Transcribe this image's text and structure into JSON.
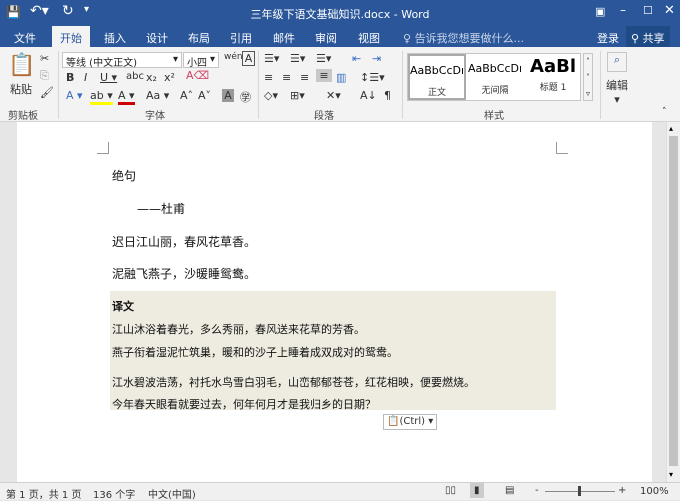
{
  "titlebar": {
    "title": "三年级下语文基础知识.docx - Word"
  },
  "tabs": [
    "文件",
    "开始",
    "插入",
    "设计",
    "布局",
    "引用",
    "邮件",
    "审阅",
    "视图"
  ],
  "tell_me": "告诉我您想要做什么...",
  "signin": "登录",
  "share": "共享",
  "ribbon": {
    "paste": "粘贴",
    "font_name": "等线 (中文正文)",
    "font_size": "小四",
    "groups": [
      "剪贴板",
      "字体",
      "段落",
      "样式",
      "编辑"
    ],
    "styles": [
      {
        "sample": "AaBbCcDı",
        "label": "正文"
      },
      {
        "sample": "AaBbCcDı",
        "label": "无间隔"
      },
      {
        "sample": "AaBl",
        "label": "标题 1"
      }
    ],
    "edit": "编辑"
  },
  "document": {
    "title": "绝句",
    "author": "——杜甫",
    "lines": [
      "迟日江山丽，春风花草香。",
      "泥融飞燕子，沙暖睡鸳鸯。"
    ],
    "translation_heading": "译文",
    "translation": [
      "江山沐浴着春光，多么秀丽，春风送来花草的芳香。",
      "燕子衔着湿泥忙筑巢，暖和的沙子上睡着成双成对的鸳鸯。",
      "江水碧波浩荡，衬托水鸟雪白羽毛，山峦郁郁苍苍，红花相映，便要燃烧。",
      "今年春天眼看就要过去，何年何月才是我归乡的日期？"
    ],
    "paste_options": "(Ctrl)"
  },
  "status": {
    "page": "第 1 页，共 1 页",
    "words": "136 个字",
    "language": "中文(中国)",
    "zoom": "100%"
  }
}
